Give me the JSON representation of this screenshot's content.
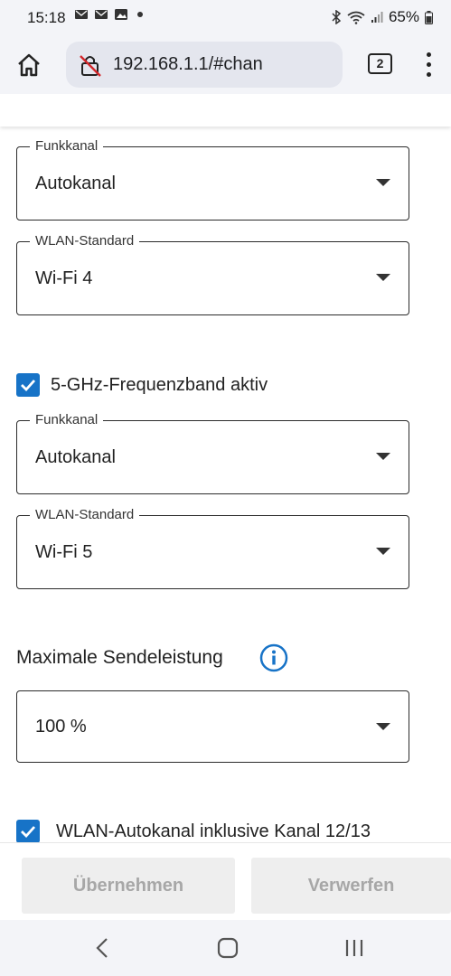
{
  "status_bar": {
    "time": "15:18",
    "battery": "65%"
  },
  "browser": {
    "url": "192.168.1.1/#chan",
    "tab_count": "2"
  },
  "band24": {
    "channel": {
      "legend": "Funkkanal",
      "value": "Autokanal"
    },
    "standard": {
      "legend": "WLAN-Standard",
      "value": "Wi-Fi 4"
    }
  },
  "band5": {
    "checkbox_label": "5-GHz-Frequenzband aktiv",
    "checked": true,
    "channel": {
      "legend": "Funkkanal",
      "value": "Autokanal"
    },
    "standard": {
      "legend": "WLAN-Standard",
      "value": "Wi-Fi 5"
    }
  },
  "power": {
    "title": "Maximale Sendeleistung",
    "value": "100 %"
  },
  "autochannel": {
    "label": "WLAN-Autokanal inklusive Kanal 12/13",
    "checked": true
  },
  "actions": {
    "apply": "Übernehmen",
    "discard": "Verwerfen"
  },
  "colors": {
    "accent": "#1773c7",
    "toolbar_bg": "#f3f4f8"
  }
}
